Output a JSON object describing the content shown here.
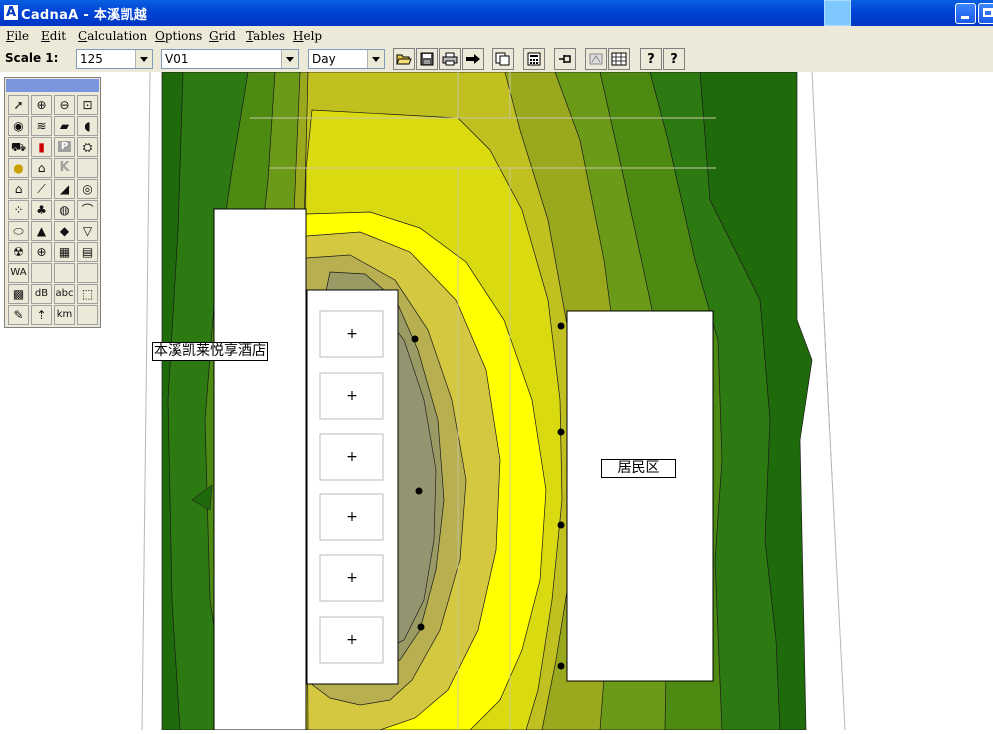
{
  "window": {
    "app_icon_letter": "A",
    "title": "CadnaA - 本溪凯越"
  },
  "menu": [
    {
      "id": "file",
      "label": "File"
    },
    {
      "id": "edit",
      "label": "Edit"
    },
    {
      "id": "calculation",
      "label": "Calculation"
    },
    {
      "id": "options",
      "label": "Options"
    },
    {
      "id": "grid",
      "label": "Grid"
    },
    {
      "id": "tables",
      "label": "Tables"
    },
    {
      "id": "help",
      "label": "Help"
    }
  ],
  "toolbar": {
    "scale_label": "Scale 1:",
    "scale_value": "125",
    "variant_value": "V01",
    "period_value": "Day",
    "help_label": "?",
    "context_help_label": "?"
  },
  "palette": {
    "icons": [
      "pointer-icon",
      "zoom-in-icon",
      "zoom-out-icon",
      "zoom-window-icon",
      "point-source-icon",
      "line-source-icon",
      "area-source-icon",
      "vertical-area-source-icon",
      "road-icon",
      "traffic-light-icon",
      "parking-lot-icon",
      "railway-icon",
      "tennis-ball-icon",
      "industrial-building-icon",
      "k-icon",
      "empty-tool",
      "building-icon",
      "barrier-icon",
      "embankment-icon",
      "cylinder-icon",
      "receiver-points-icon",
      "trees-icon",
      "contour-icon",
      "bridge-icon",
      "tank-icon",
      "terrain-icon",
      "ground-absorption-icon",
      "triangle-down-icon",
      "radiation-icon",
      "globe-icon",
      "grid-area-icon",
      "section-icon",
      "wa-icon",
      "empty-tool",
      "empty-tool",
      "empty-tool",
      "map-icon",
      "db-icon",
      "text-icon",
      "dotted-box-icon",
      "edit-polygon-icon",
      "height-point-icon",
      "km-icon",
      "empty-tool"
    ],
    "tool_text": {
      "k-icon": "K",
      "parking-lot-icon": "P",
      "db-icon": "dB",
      "text-icon": "abc",
      "wa-icon": "WA",
      "km-icon": "km"
    }
  },
  "map": {
    "hotel_label": "本溪凯莱悦享酒店",
    "residential_label": "居民区",
    "room_marker": "+",
    "contour_colors": [
      "#1f6a0a",
      "#2d7a12",
      "#4d8a12",
      "#6b9a18",
      "#9aa81e",
      "#c0c020",
      "#dada10",
      "#ffff00",
      "#d4c840",
      "#b8b050",
      "#9a9a64"
    ]
  }
}
